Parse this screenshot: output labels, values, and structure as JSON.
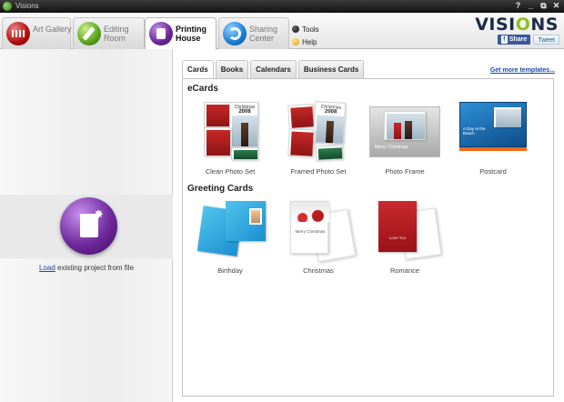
{
  "window": {
    "title": "Visions",
    "controls": [
      "?",
      "_",
      "⧉",
      "✕"
    ]
  },
  "tabs": [
    {
      "label": "Art Gallery",
      "active": false,
      "icon": "art-gallery-icon"
    },
    {
      "label": "Editing Room",
      "active": false,
      "icon": "pencil-icon"
    },
    {
      "label": "Printing House",
      "active": true,
      "icon": "document-icon"
    },
    {
      "label": "Sharing Center",
      "active": false,
      "icon": "share-arc-icon"
    }
  ],
  "top_links": {
    "tools": "Tools",
    "help": "Help"
  },
  "brand": {
    "name": "VISIONS",
    "share_label": "Share",
    "share_glyph": "f",
    "tweet_label": "Tweet"
  },
  "left_panel": {
    "load_link": "Load",
    "load_rest": " existing project from file"
  },
  "category_tabs": [
    "Cards",
    "Books",
    "Calendars",
    "Business Cards"
  ],
  "active_category": "Cards",
  "more_templates": "Get more templates...",
  "sections": {
    "ecards": {
      "title": "eCards",
      "items": [
        "Clean Photo Set",
        "Framed Photo Set",
        "Photo Frame",
        "Postcard"
      ]
    },
    "greeting": {
      "title": "Greeting Cards",
      "items": [
        "Birthday",
        "Christmas",
        "Romance"
      ]
    }
  },
  "thumb_text": {
    "year": "2008",
    "christmas": "Christmas",
    "frame_caption": "Merry Christmas",
    "postcard_caption": "A Day at the Beach",
    "merry_christmas": "Merry Christmas",
    "romance_caption": "Love You"
  },
  "colors": {
    "accent_link": "#1a4aa8",
    "brand_green": "#8ec21c",
    "brand_navy": "#1d2b4a"
  }
}
